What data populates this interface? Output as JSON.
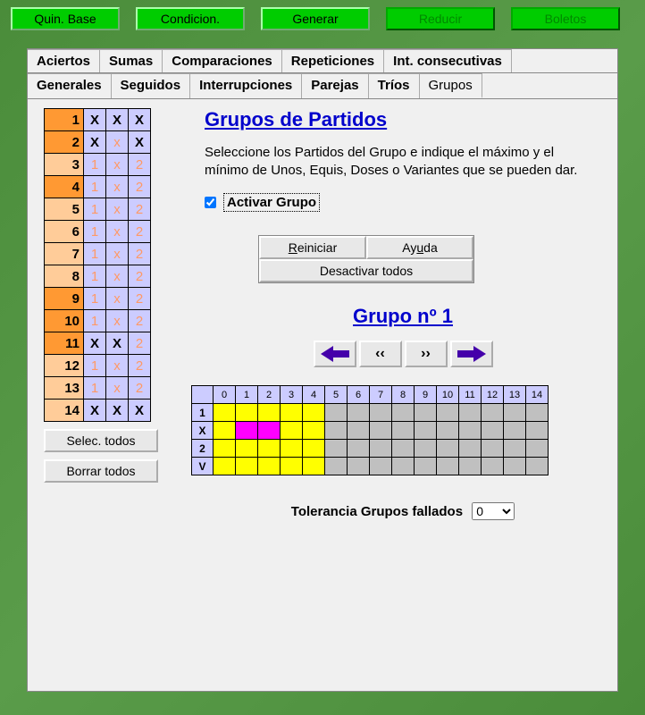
{
  "topButtons": {
    "quinBase": "Quin. Base",
    "condicion": "Condicion.",
    "generar": "Generar",
    "reducir": "Reducir",
    "boletos": "Boletos"
  },
  "tabsRow1": {
    "aciertos": "Aciertos",
    "sumas": "Sumas",
    "comparaciones": "Comparaciones",
    "repeticiones": "Repeticiones",
    "intConsecutivas": "Int. consecutivas"
  },
  "tabsRow2": {
    "generales": "Generales",
    "seguidos": "Seguidos",
    "interrupciones": "Interrupciones",
    "parejas": "Parejas",
    "trios": "Tríos",
    "grupos": "Grupos"
  },
  "matches": [
    {
      "n": "1",
      "c1": "X",
      "c2": "X",
      "c3": "X",
      "bold": true,
      "dark": true
    },
    {
      "n": "2",
      "c1": "X",
      "c2": "x",
      "c3": "X",
      "bold": true,
      "dark": true,
      "mid": true
    },
    {
      "n": "3",
      "c1": "1",
      "c2": "x",
      "c3": "2",
      "bold": false,
      "dark": false
    },
    {
      "n": "4",
      "c1": "1",
      "c2": "x",
      "c3": "2",
      "bold": false,
      "dark": true
    },
    {
      "n": "5",
      "c1": "1",
      "c2": "x",
      "c3": "2",
      "bold": false,
      "dark": false
    },
    {
      "n": "6",
      "c1": "1",
      "c2": "x",
      "c3": "2",
      "bold": false,
      "dark": false
    },
    {
      "n": "7",
      "c1": "1",
      "c2": "x",
      "c3": "2",
      "bold": false,
      "dark": false
    },
    {
      "n": "8",
      "c1": "1",
      "c2": "x",
      "c3": "2",
      "bold": false,
      "dark": false
    },
    {
      "n": "9",
      "c1": "1",
      "c2": "x",
      "c3": "2",
      "bold": false,
      "dark": true
    },
    {
      "n": "10",
      "c1": "1",
      "c2": "x",
      "c3": "2",
      "bold": false,
      "dark": true
    },
    {
      "n": "11",
      "c1": "X",
      "c2": "X",
      "c3": "2",
      "bold": true,
      "dark": true,
      "last": true
    },
    {
      "n": "12",
      "c1": "1",
      "c2": "x",
      "c3": "2",
      "bold": false,
      "dark": false
    },
    {
      "n": "13",
      "c1": "1",
      "c2": "x",
      "c3": "2",
      "bold": false,
      "dark": false
    },
    {
      "n": "14",
      "c1": "X",
      "c2": "X",
      "c3": "X",
      "bold": true,
      "dark": false
    }
  ],
  "leftButtons": {
    "selecTodos": "Selec. todos",
    "borrarTodos": "Borrar todos"
  },
  "right": {
    "title": "Grupos de Partidos",
    "desc": "Seleccione los Partidos del Grupo e indique el máximo y el mínimo de Unos, Equis, Doses o Variantes que se pueden dar.",
    "activar": "Activar Grupo",
    "reiniciar": "Reiniciar",
    "ayuda": "Ayuda",
    "desactivar": "Desactivar todos",
    "groupTitle": "Grupo nº 1",
    "navPrev2": "‹‹",
    "navNext2": "››"
  },
  "grid": {
    "cols": [
      "0",
      "1",
      "2",
      "3",
      "4",
      "5",
      "6",
      "7",
      "8",
      "9",
      "10",
      "11",
      "12",
      "13",
      "14"
    ],
    "rows": [
      "1",
      "X",
      "2",
      "V"
    ],
    "cells": {
      "row0": [
        "yellow",
        "yellow",
        "yellow",
        "yellow",
        "yellow",
        "",
        "",
        "",
        "",
        "",
        "",
        "",
        "",
        "",
        ""
      ],
      "row1": [
        "yellow",
        "magenta",
        "magenta",
        "yellow",
        "yellow",
        "",
        "",
        "",
        "",
        "",
        "",
        "",
        "",
        "",
        ""
      ],
      "row2": [
        "yellow",
        "yellow",
        "yellow",
        "yellow",
        "yellow",
        "",
        "",
        "",
        "",
        "",
        "",
        "",
        "",
        "",
        ""
      ],
      "row3": [
        "yellow",
        "yellow",
        "yellow",
        "yellow",
        "yellow",
        "",
        "",
        "",
        "",
        "",
        "",
        "",
        "",
        "",
        ""
      ]
    }
  },
  "tolerance": {
    "label": "Tolerancia Grupos fallados",
    "value": "0"
  }
}
